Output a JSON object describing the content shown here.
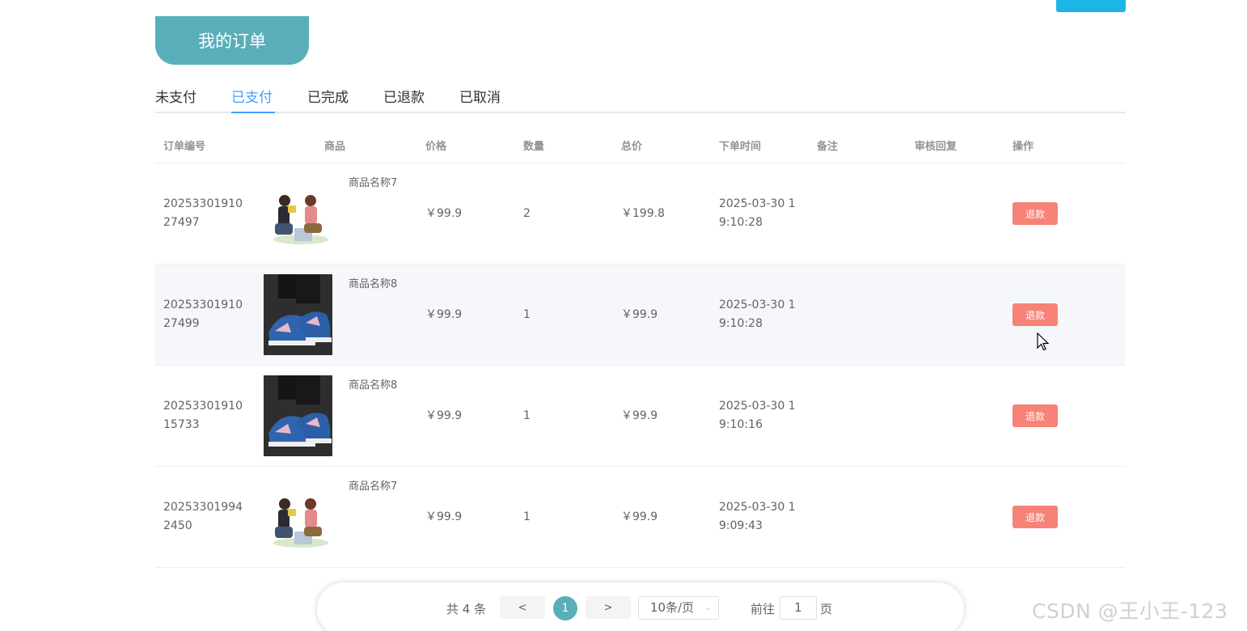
{
  "page_title": "我的订单",
  "tabs": [
    {
      "label": "未支付"
    },
    {
      "label": "已支付"
    },
    {
      "label": "已完成"
    },
    {
      "label": "已退款"
    },
    {
      "label": "已取消"
    }
  ],
  "active_tab": "已支付",
  "columns": {
    "order_no": "订单编号",
    "product": "商品",
    "price": "价格",
    "qty": "数量",
    "total": "总价",
    "time": "下单时间",
    "remark": "备注",
    "review": "审核回复",
    "action": "操作"
  },
  "rows": [
    {
      "order_no": "2025330191027497",
      "image": "illustration-couple",
      "name": "商品名称7",
      "price": "￥99.9",
      "qty": "2",
      "total": "￥199.8",
      "time": "2025-03-30 19:10:28",
      "remark": "",
      "review": "",
      "action": "退款"
    },
    {
      "order_no": "2025330191027499",
      "image": "sneaker-photo",
      "name": "商品名称8",
      "price": "￥99.9",
      "qty": "1",
      "total": "￥99.9",
      "time": "2025-03-30 19:10:28",
      "remark": "",
      "review": "",
      "action": "退款"
    },
    {
      "order_no": "2025330191015733",
      "image": "sneaker-photo",
      "name": "商品名称8",
      "price": "￥99.9",
      "qty": "1",
      "total": "￥99.9",
      "time": "2025-03-30 19:10:16",
      "remark": "",
      "review": "",
      "action": "退款"
    },
    {
      "order_no": "202533019942450",
      "image": "illustration-couple",
      "name": "商品名称7",
      "price": "￥99.9",
      "qty": "1",
      "total": "￥99.9",
      "time": "2025-03-30 19:09:43",
      "remark": "",
      "review": "",
      "action": "退款"
    }
  ],
  "pagination": {
    "total": "共 4 条",
    "prev": "<",
    "current": "1",
    "next": ">",
    "page_size": "10条/页",
    "goto_label": "前往",
    "goto_value": "1",
    "page_suffix": "页"
  },
  "watermark": "CSDN @王小王-123",
  "colors": {
    "accent": "#5aaeba",
    "tab_active": "#409eff",
    "refund": "#f78277",
    "top_button": "#1eb4e8"
  }
}
